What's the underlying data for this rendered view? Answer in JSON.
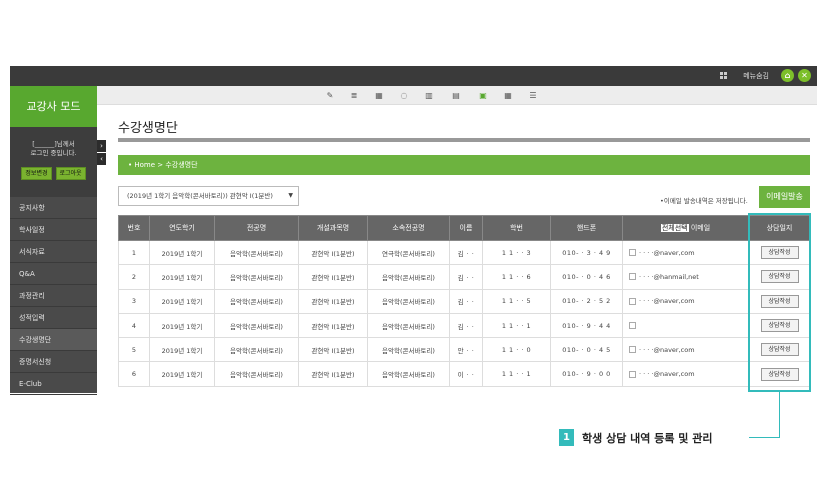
{
  "topbar": {
    "menu_label": "메뉴숨김",
    "home_icon": "home-icon",
    "close_icon": "close-icon"
  },
  "sidebar": {
    "title": "교강사 모드",
    "login_line1": "[______]님께서",
    "login_line2": "로그인 중입니다.",
    "info_button": "정보변경",
    "logout_button": "로그아웃",
    "items": [
      "공지사항",
      "학사일정",
      "서식자료",
      "Q&A",
      "과정관리",
      "성적입력",
      "수강생명단",
      "증명서신청",
      "E-Club"
    ]
  },
  "page": {
    "title": "수강생명단",
    "breadcrumb": "• Home > 수강생명단",
    "course_select": "(2019년 1학기 음악학(콘서바토리)) 관현악 I(1분반)",
    "email_note": "•이메일 발송내역은 저장됩니다.",
    "email_button": "이메일발송"
  },
  "table": {
    "headers": {
      "no": "번호",
      "term": "연도학기",
      "major": "전공명",
      "course": "개설과목명",
      "dept": "소속전공명",
      "name": "이름",
      "student_id": "학번",
      "phone": "핸드폰",
      "select_all": "전체선택",
      "email": "이메일",
      "consult": "상담일지"
    },
    "consult_button": "상담작성",
    "rows": [
      {
        "no": "1",
        "term": "2019년 1학기",
        "major": "음악학(콘서바토리)",
        "course": "관현악 I(1분반)",
        "dept": "연극학(콘서바토리)",
        "name": "김 ·  ·",
        "student_id": "1 1 ·  · 3",
        "phone": "010- ·  3 ·  4 9",
        "email": "·  ·  ·  ·@naver,com"
      },
      {
        "no": "2",
        "term": "2019년 1학기",
        "major": "음악학(콘서바토리)",
        "course": "관현악 I(1분반)",
        "dept": "음악학(콘서바토리)",
        "name": "김 ·  ·",
        "student_id": "1 1 ·  · 6",
        "phone": "010- ·  0 ·  4 6",
        "email": "·  ·  ·  ·@hanmail,net"
      },
      {
        "no": "3",
        "term": "2019년 1학기",
        "major": "음악학(콘서바토리)",
        "course": "관현악 I(1분반)",
        "dept": "음악학(콘서바토리)",
        "name": "김 ·  ·",
        "student_id": "1 1 ·  · 5",
        "phone": "010- ·  2 ·  5 2",
        "email": "·  ·  ·  ·@naver,com"
      },
      {
        "no": "4",
        "term": "2019년 1학기",
        "major": "음악학(콘서바토리)",
        "course": "관현악 I(1분반)",
        "dept": "음악학(콘서바토리)",
        "name": "김 ·  ·",
        "student_id": "1 1 ·  · 1",
        "phone": "010- ·  9 ·  4 4",
        "email": ""
      },
      {
        "no": "5",
        "term": "2019년 1학기",
        "major": "음악학(콘서바토리)",
        "course": "관현악 I(1분반)",
        "dept": "음악학(콘서바토리)",
        "name": "안 ·  ·",
        "student_id": "1 1 ·  · 0",
        "phone": "010- ·  0 ·  4 5",
        "email": "·  ·  ·  ·@naver,com"
      },
      {
        "no": "6",
        "term": "2019년 1학기",
        "major": "음악학(콘서바토리)",
        "course": "관현악 I(1분반)",
        "dept": "음악학(콘서바토리)",
        "name": "이 ·  ·",
        "student_id": "1 1 ·  · 1",
        "phone": "010- ·  9 ·  0 0",
        "email": "·  ·  ·  ·@naver,com"
      }
    ]
  },
  "callout": {
    "number": "1",
    "text": "학생 상담 내역 등록 및 관리"
  },
  "colors": {
    "accent_green": "#6db33f",
    "highlight_teal": "#33bbbb",
    "dark_bar": "#3a3a3a"
  }
}
